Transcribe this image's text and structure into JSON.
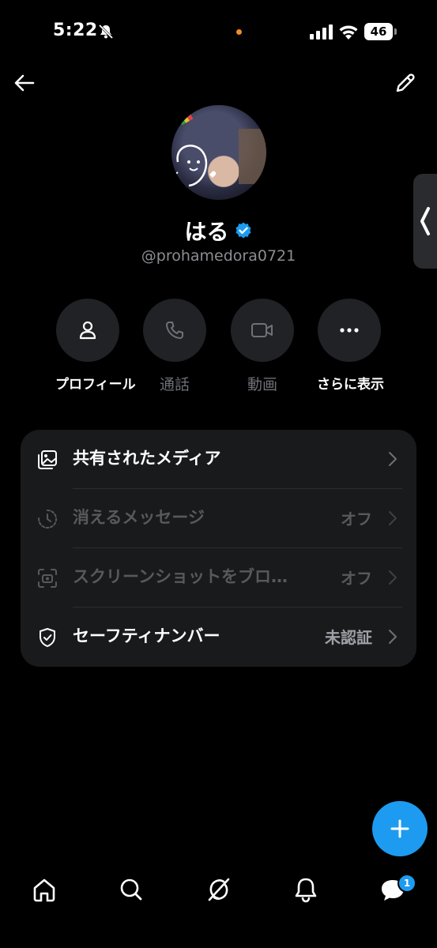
{
  "status_bar": {
    "time": "5:22",
    "battery": "46"
  },
  "profile": {
    "name": "はる",
    "handle": "@prohamedora0721"
  },
  "actions": [
    {
      "label": "プロフィール",
      "icon": "person-icon",
      "enabled": true
    },
    {
      "label": "通話",
      "icon": "phone-icon",
      "enabled": false
    },
    {
      "label": "動画",
      "icon": "video-icon",
      "enabled": false
    },
    {
      "label": "さらに表示",
      "icon": "more-icon",
      "enabled": true
    }
  ],
  "settings": [
    {
      "title": "共有されたメディア",
      "value": "",
      "icon": "media-icon",
      "enabled": true
    },
    {
      "title": "消えるメッセージ",
      "value": "オフ",
      "icon": "timer-icon",
      "enabled": false
    },
    {
      "title": "スクリーンショットをブロ…",
      "value": "オフ",
      "icon": "screenshot-icon",
      "enabled": false
    },
    {
      "title": "セーフティナンバー",
      "value": "未認証",
      "icon": "shield-icon",
      "enabled": true
    }
  ],
  "nav": {
    "items": [
      "home-icon",
      "search-icon",
      "grok-icon",
      "bell-icon",
      "messages-icon"
    ],
    "messages_badge": "1"
  },
  "colors": {
    "accent": "#1d9bf0",
    "background": "#000000",
    "card": "#191a1c"
  }
}
